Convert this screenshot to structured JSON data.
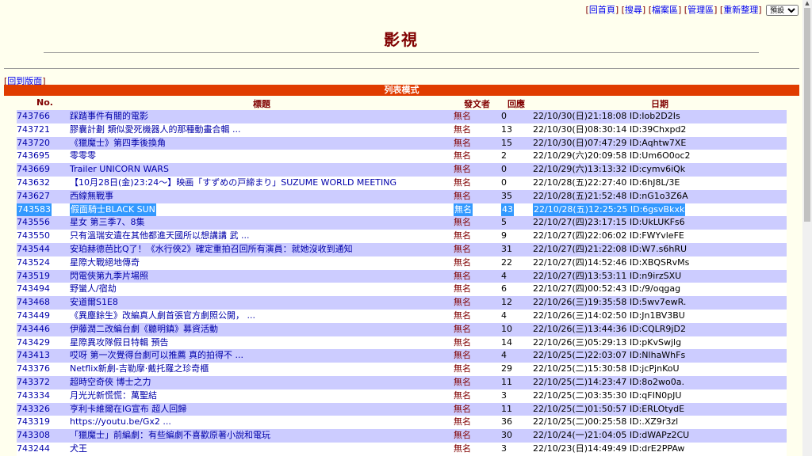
{
  "toplinks": {
    "home": "回首頁",
    "search": "搜尋",
    "files": "檔案區",
    "admin": "管理區",
    "refresh": "重新整理",
    "select_value": "預設"
  },
  "page_title": "影視",
  "return_link": "回到版面",
  "mode_label": "列表模式",
  "headers": {
    "no": "No.",
    "title": "標題",
    "author": "發文者",
    "reply": "回應",
    "date": "日期"
  },
  "rows": [
    {
      "no": "743766",
      "title": "踩踏事件有關的電影",
      "author": "無名",
      "reply": "0",
      "date": "22/10/30(日)21:18:08 ID:Iob2D2Is"
    },
    {
      "no": "743721",
      "title": "膠囊計劃 類似愛死機器人的那種動畫合輯 ...",
      "author": "無名",
      "reply": "13",
      "date": "22/10/30(日)08:30:14 ID:39Chxpd2"
    },
    {
      "no": "743720",
      "title": "《獵魔士》第四季後換角",
      "author": "無名",
      "reply": "15",
      "date": "22/10/30(日)07:47:29 ID:Aqhtw7XE"
    },
    {
      "no": "743695",
      "title": "零零零",
      "author": "無名",
      "reply": "2",
      "date": "22/10/29(六)20:09:58 ID:Um6O0oc2"
    },
    {
      "no": "743669",
      "title": "Trailer UNICORN WARS",
      "author": "無名",
      "reply": "0",
      "date": "22/10/29(六)13:13:32 ID:cymv6iQk"
    },
    {
      "no": "743632",
      "title": "【10月28日(金)23:24～】映画「すずめの戸締まり」SUZUME WORLD MEETING",
      "author": "無名",
      "reply": "0",
      "date": "22/10/28(五)22:27:40 ID:6hJ8L/3E"
    },
    {
      "no": "743627",
      "title": "西線無戰事",
      "author": "無名",
      "reply": "35",
      "date": "22/10/28(五)21:52:48 ID:nG1o3Z6A"
    },
    {
      "no": "743583",
      "title": "假面騎士BLACK SUN",
      "author": "無名",
      "reply": "43",
      "date": "22/10/28(五)12:25:25 ID:6gsvBkxk",
      "selected": true
    },
    {
      "no": "743556",
      "title": "星女 第三季7、8集",
      "author": "無名",
      "reply": "5",
      "date": "22/10/27(四)23:17:15 ID:UkLUKFs6"
    },
    {
      "no": "743550",
      "title": "只有溫瑞安遺在其他都進天國所以想講講 武 ...",
      "author": "無名",
      "reply": "9",
      "date": "22/10/27(四)22:06:02 ID:FWYvleFE"
    },
    {
      "no": "743544",
      "title": "安珀赫德芭比Q了！《水行俠2》確定重拍召回所有演員：就她沒收到通知",
      "author": "無名",
      "reply": "31",
      "date": "22/10/27(四)21:22:08 ID:W7.s6hRU"
    },
    {
      "no": "743524",
      "title": "星際大戰絕地傳奇",
      "author": "無名",
      "reply": "22",
      "date": "22/10/27(四)14:52:46 ID:XBQSRvMs"
    },
    {
      "no": "743519",
      "title": "閃電俠第九季片場照",
      "author": "無名",
      "reply": "4",
      "date": "22/10/27(四)13:53:11 ID:n9irzSXU"
    },
    {
      "no": "743494",
      "title": "野蠻人/宿劫",
      "author": "無名",
      "reply": "6",
      "date": "22/10/27(四)00:52:43 ID:/9/oqgag"
    },
    {
      "no": "743468",
      "title": "安道爾S1E8",
      "author": "無名",
      "reply": "12",
      "date": "22/10/26(三)19:35:58 ID:5wv7ewR."
    },
    {
      "no": "743449",
      "title": "《異塵餘生》改編真人劇首張官方劇照公開， ...",
      "author": "無名",
      "reply": "4",
      "date": "22/10/26(三)14:02:50 ID:Jn1BV3BU"
    },
    {
      "no": "743446",
      "title": "伊藤潤二改編台劇《聽明鎮》募資活動",
      "author": "無名",
      "reply": "10",
      "date": "22/10/26(三)13:44:36 ID:CQLR9jD2"
    },
    {
      "no": "743429",
      "title": "星際異攻隊假日特輯 預告",
      "author": "無名",
      "reply": "14",
      "date": "22/10/26(三)05:29:13 ID:pKvSwjlg"
    },
    {
      "no": "743413",
      "title": "哎呀 第一次覺得台劇可以推薦 真的拍得不 ...",
      "author": "無名",
      "reply": "4",
      "date": "22/10/25(二)22:03:07 ID:NlhaWhFs"
    },
    {
      "no": "743376",
      "title": "Netflix新劇-吉勒摩·戴托羅之珍奇櫃",
      "author": "無名",
      "reply": "29",
      "date": "22/10/25(二)15:30:58 ID:jcPjnKoU"
    },
    {
      "no": "743372",
      "title": "超時空奇俠 博士之力",
      "author": "無名",
      "reply": "11",
      "date": "22/10/25(二)14:23:47 ID:8o2wo0a."
    },
    {
      "no": "743334",
      "title": "月光光新慌慌：萬聖結",
      "author": "無名",
      "reply": "3",
      "date": "22/10/25(二)03:35:30 ID:qFIN0pJU"
    },
    {
      "no": "743326",
      "title": "亨利卡維爾在IG宣布 超人回歸",
      "author": "無名",
      "reply": "11",
      "date": "22/10/25(二)01:50:57 ID:ERLOtydE"
    },
    {
      "no": "743319",
      "title": "https://youtu.be/Gx2 ...",
      "author": "無名",
      "reply": "36",
      "date": "22/10/25(二)00:25:58 ID:.XZ9r3zl"
    },
    {
      "no": "743308",
      "title": "「獵魔士」前編劇：有些編劇不喜歡原著小說和電玩",
      "author": "無名",
      "reply": "30",
      "date": "22/10/24(一)21:04:05 ID:dWAPz2CU"
    },
    {
      "no": "743244",
      "title": "犬王",
      "author": "無名",
      "reply": "3",
      "date": "22/10/23(日)14:49:49 ID:drE2PPAw"
    }
  ]
}
